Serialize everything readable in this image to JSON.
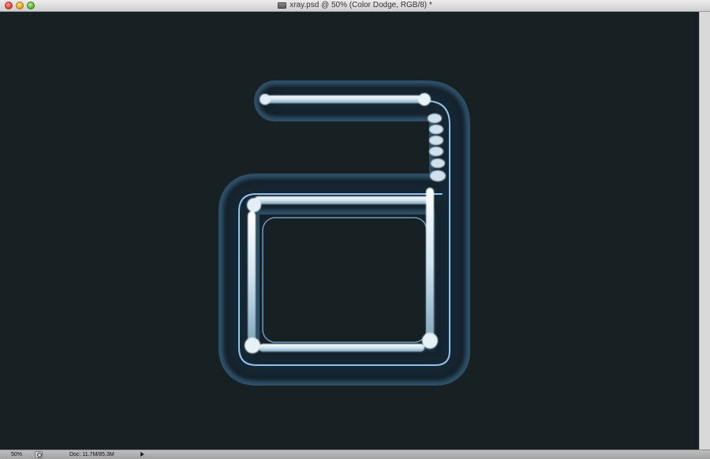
{
  "window": {
    "title": "xray.psd @ 50% (Color Dodge, RGB/8) *"
  },
  "status": {
    "zoom": "50%",
    "doc_info": "Doc: 11.7M/85.3M"
  },
  "colors": {
    "canvas_background": "#172023",
    "glow": "#4da8ff",
    "bone": "#e4f0f6"
  },
  "icons": {
    "close": "close-button",
    "minimize": "minimize-button",
    "maximize": "zoom-button",
    "document": "document-icon",
    "cycle": "status-cycle-icon",
    "arrow": "play-arrow-icon"
  }
}
